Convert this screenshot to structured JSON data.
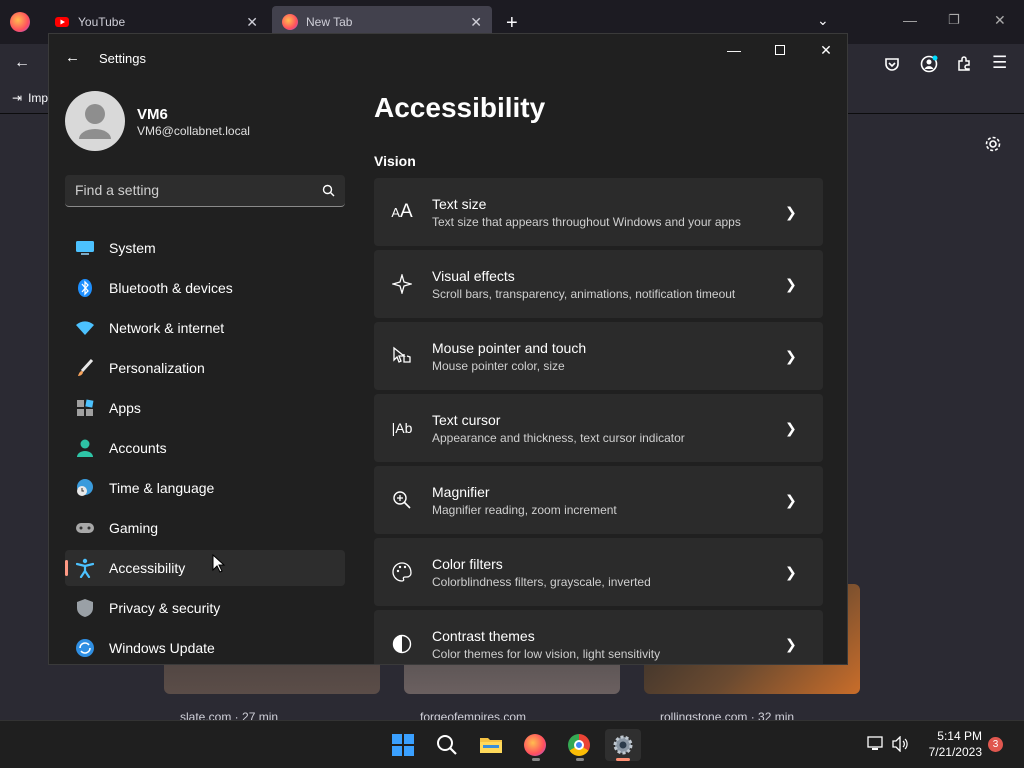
{
  "browser": {
    "tabs": [
      {
        "label": "YouTube"
      },
      {
        "label": "New Tab"
      }
    ],
    "bookmark_partial": "Imp",
    "tiles": [
      {
        "caption": "slate.com · 27 min"
      },
      {
        "caption": "forgeofempires.com"
      },
      {
        "caption": "rollingstone.com · 32 min"
      }
    ]
  },
  "settings": {
    "title": "Settings",
    "profile": {
      "name": "VM6",
      "email": "VM6@collabnet.local"
    },
    "search_placeholder": "Find a setting",
    "nav": [
      {
        "label": "System",
        "icon": "monitor-icon"
      },
      {
        "label": "Bluetooth & devices",
        "icon": "bluetooth-icon"
      },
      {
        "label": "Network & internet",
        "icon": "wifi-icon"
      },
      {
        "label": "Personalization",
        "icon": "brush-icon"
      },
      {
        "label": "Apps",
        "icon": "apps-icon"
      },
      {
        "label": "Accounts",
        "icon": "person-icon"
      },
      {
        "label": "Time & language",
        "icon": "globe-clock-icon"
      },
      {
        "label": "Gaming",
        "icon": "gamepad-icon"
      },
      {
        "label": "Accessibility",
        "icon": "accessibility-icon",
        "selected": true
      },
      {
        "label": "Privacy & security",
        "icon": "shield-icon"
      },
      {
        "label": "Windows Update",
        "icon": "update-icon"
      }
    ],
    "page_title": "Accessibility",
    "section": "Vision",
    "cards": [
      {
        "title": "Text size",
        "subtitle": "Text size that appears throughout Windows and your apps",
        "icon": "text-size-icon"
      },
      {
        "title": "Visual effects",
        "subtitle": "Scroll bars, transparency, animations, notification timeout",
        "icon": "sparkle-icon"
      },
      {
        "title": "Mouse pointer and touch",
        "subtitle": "Mouse pointer color, size",
        "icon": "pointer-icon"
      },
      {
        "title": "Text cursor",
        "subtitle": "Appearance and thickness, text cursor indicator",
        "icon": "text-cursor-icon"
      },
      {
        "title": "Magnifier",
        "subtitle": "Magnifier reading, zoom increment",
        "icon": "magnifier-icon"
      },
      {
        "title": "Color filters",
        "subtitle": "Colorblindness filters, grayscale, inverted",
        "icon": "palette-icon"
      },
      {
        "title": "Contrast themes",
        "subtitle": "Color themes for low vision, light sensitivity",
        "icon": "contrast-icon"
      }
    ]
  },
  "taskbar": {
    "time": "5:14 PM",
    "date": "7/21/2023",
    "notification_count": "3",
    "apps": [
      "start-icon",
      "search-icon",
      "file-explorer-icon",
      "firefox-icon",
      "chrome-icon",
      "settings-icon"
    ]
  }
}
